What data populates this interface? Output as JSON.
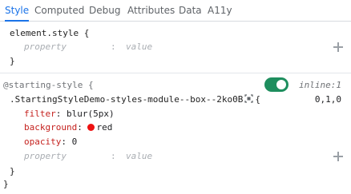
{
  "tabs": [
    {
      "label": "Style",
      "active": true
    },
    {
      "label": "Computed",
      "active": false
    },
    {
      "label": "Debug",
      "active": false
    },
    {
      "label": "Attributes",
      "active": false
    },
    {
      "label": "Data",
      "active": false
    },
    {
      "label": "A11y",
      "active": false
    }
  ],
  "element_style": {
    "selector": "element.style",
    "open_brace": "{",
    "close_brace": "}",
    "placeholder_property": "property",
    "placeholder_value": "value",
    "colon": ":"
  },
  "starting_style": {
    "at_rule": "@starting-style {",
    "enabled": true,
    "source": "inline:1",
    "selector": ".StartingStyleDemo-styles-module--box--2ko0B",
    "open_brace": "{",
    "specificity": "0,1,0",
    "declarations": [
      {
        "property": "filter",
        "colon": ":",
        "value": "blur(5px)"
      },
      {
        "property": "background",
        "colon": ":",
        "value": "red",
        "swatch_color": "#ee1111"
      },
      {
        "property": "opacity",
        "colon": ":",
        "value": "0"
      }
    ],
    "placeholder_property": "property",
    "placeholder_value": "value",
    "colon": ":",
    "close_brace": "}",
    "at_rule_close": "}"
  },
  "colors": {
    "accent": "#1a73e8",
    "toggle_on": "#1e8e5e",
    "property_name": "#c5221f"
  },
  "icons": {
    "add": "plus-icon",
    "selector_picker": "element-picker-icon",
    "toggle": "toggle-switch"
  }
}
